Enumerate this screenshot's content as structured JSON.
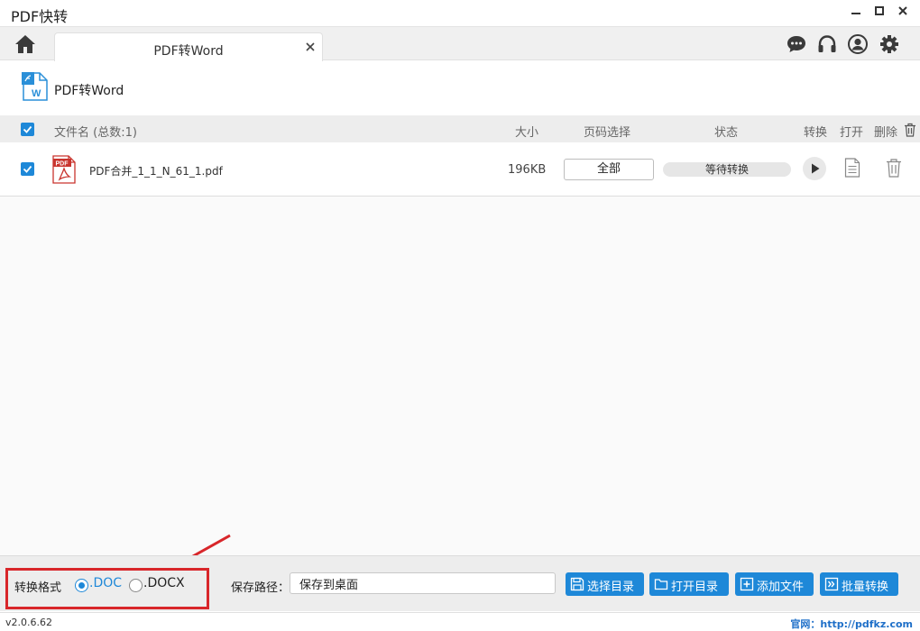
{
  "window": {
    "title": "PDF快转",
    "minimize_icon": "minimize-icon",
    "maximize_icon": "maximize-icon",
    "close_icon": "close-icon"
  },
  "tabbar": {
    "home_icon": "home-icon",
    "active_tab_label": "PDF转Word",
    "right_icons": [
      "chat-icon",
      "headset-icon",
      "user-icon",
      "gear-icon"
    ]
  },
  "page": {
    "title": "PDF转Word",
    "icon": "word-doc-icon"
  },
  "table": {
    "header": {
      "name": "文件名 (总数:1)",
      "size": "大小",
      "pages": "页码选择",
      "status": "状态",
      "convert": "转换",
      "open": "打开",
      "delete": "删除"
    },
    "rows": [
      {
        "filename": "PDF合并_1_1_N_61_1.pdf",
        "size": "196KB",
        "pages": "全部",
        "status": "等待转换",
        "checked": true
      }
    ]
  },
  "footer": {
    "format_label": "转换格式",
    "formats": [
      {
        "label": ".DOC",
        "selected": true
      },
      {
        "label": ".DOCX",
        "selected": false
      }
    ],
    "save_path_label": "保存路径：",
    "save_path_value": "保存到桌面",
    "buttons": {
      "choose_dir": "选择目录",
      "open_dir": "打开目录",
      "add_file": "添加文件",
      "batch_convert": "批量转换"
    }
  },
  "statusbar": {
    "version": "v2.0.6.62",
    "website": "官网：http://pdfkz.com"
  },
  "colors": {
    "accent": "#1e88d8",
    "annotation": "#d8262a",
    "pdf_red": "#c9342e"
  }
}
